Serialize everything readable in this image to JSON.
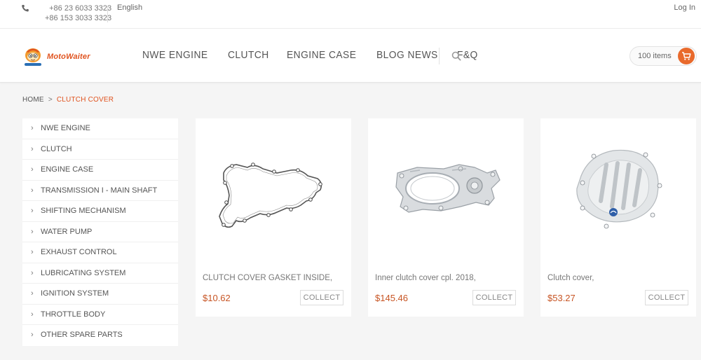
{
  "topbar": {
    "phone1": "+86 23 6033 3323",
    "phone2": "+86 153 3033 3323",
    "language": "English",
    "login": "Log In"
  },
  "header": {
    "logo_text": "MotoWaiter",
    "nav": [
      "NWE ENGINE",
      "CLUTCH",
      "ENGINE CASE",
      "BLOG NEWS",
      "F&Q"
    ],
    "cart_label": "100 items"
  },
  "breadcrumb": {
    "home": "HOME",
    "separator": ">",
    "current": "CLUTCH COVER"
  },
  "sidebar": {
    "items": [
      "NWE ENGINE",
      "CLUTCH",
      "ENGINE CASE",
      "TRANSMISSION I - MAIN SHAFT",
      "SHIFTING MECHANISM",
      "WATER PUMP",
      "EXHAUST CONTROL",
      "LUBRICATING SYSTEM",
      "IGNITION SYSTEM",
      "THROTTLE BODY",
      "OTHER SPARE PARTS"
    ]
  },
  "products": [
    {
      "name": "CLUTCH COVER GASKET INSIDE,",
      "price": "$10.62",
      "collect": "COLLECT",
      "image": "gasket"
    },
    {
      "name": "Inner clutch cover cpl. 2018,",
      "price": "$145.46",
      "collect": "COLLECT",
      "image": "inner-cover"
    },
    {
      "name": "Clutch cover,",
      "price": "$53.27",
      "collect": "COLLECT",
      "image": "cover"
    }
  ],
  "colors": {
    "accent": "#e0531f",
    "price": "#c75423",
    "cart": "#e96a2c",
    "background": "#f5f5f5"
  },
  "icons": {
    "phone": "phone-icon",
    "search": "search-icon",
    "cart": "cart-icon",
    "chevron": "chevron-right-icon"
  }
}
